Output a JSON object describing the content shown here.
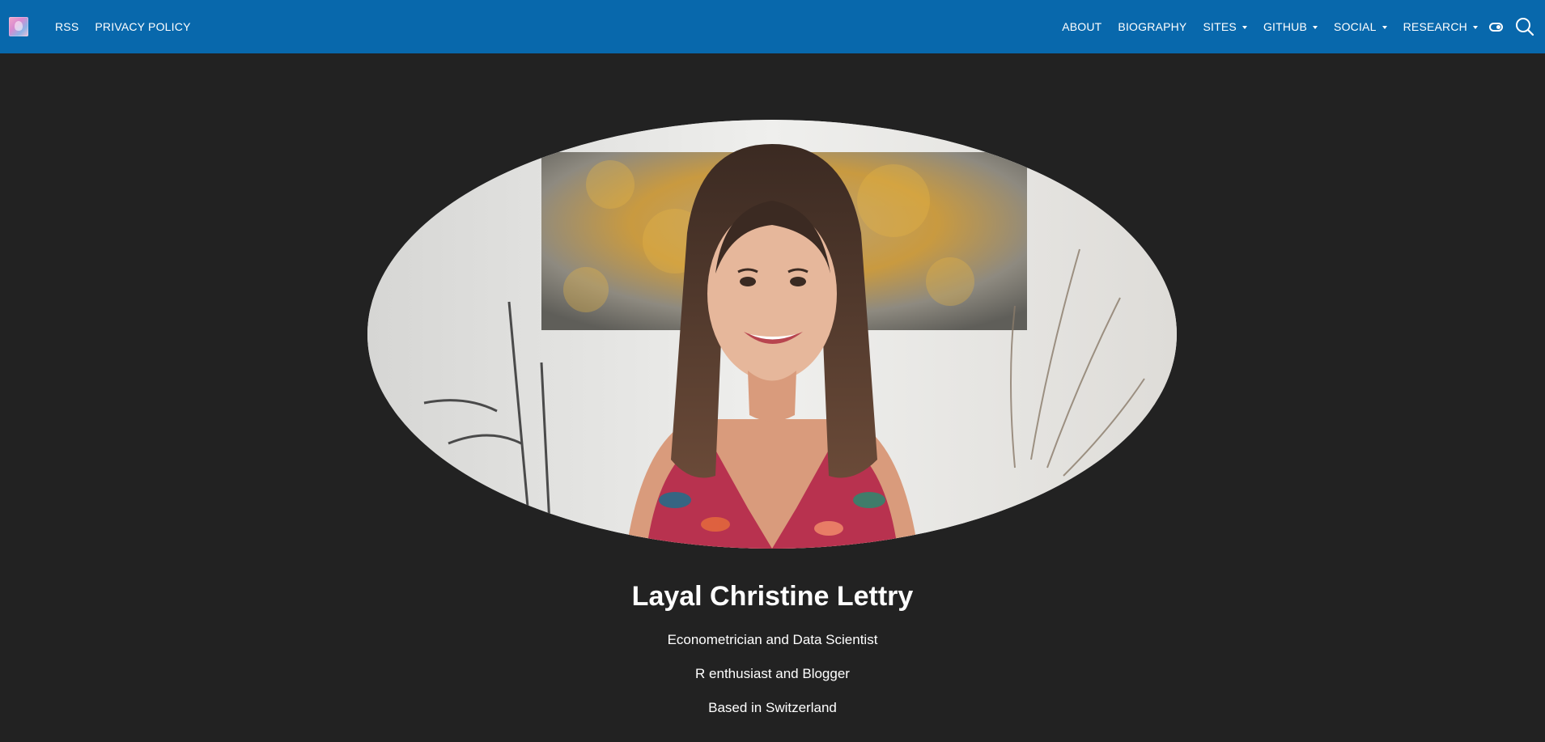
{
  "nav": {
    "left": [
      {
        "label": "RSS"
      },
      {
        "label": "PRIVACY POLICY"
      }
    ],
    "right": [
      {
        "label": "ABOUT"
      },
      {
        "label": "BIOGRAPHY"
      },
      {
        "label": "SITES"
      },
      {
        "label": "GITHUB"
      },
      {
        "label": "SOCIAL"
      },
      {
        "label": "RESEARCH"
      }
    ],
    "icons": [
      "site-logo-icon",
      "dark-mode-toggle-icon",
      "search-icon"
    ]
  },
  "profile": {
    "name": "Layal Christine Lettry",
    "taglines": [
      "Econometrician and Data Scientist",
      "R enthusiast and Blogger",
      "Based in Switzerland"
    ]
  },
  "colors": {
    "navbar": "#0868ac",
    "background": "#222222",
    "text": "#ffffff"
  }
}
